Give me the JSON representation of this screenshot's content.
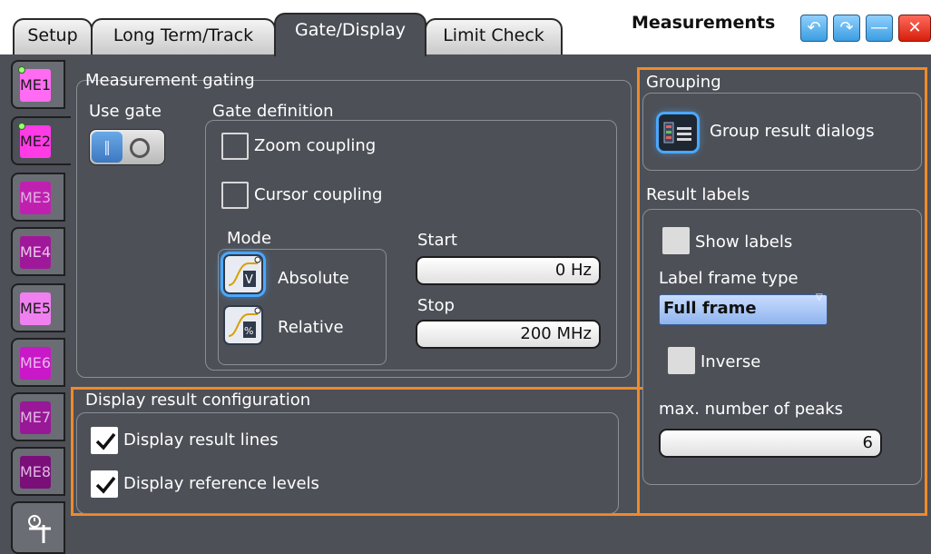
{
  "tabs": [
    "Setup",
    "Long Term/Track",
    "Gate/Display",
    "Limit Check"
  ],
  "window": {
    "title": "Measurements",
    "icons": [
      "undo-icon",
      "redo-icon",
      "minimize-icon",
      "close-icon"
    ]
  },
  "side_tabs": [
    {
      "label": "ME1",
      "color": "#ff6bf2"
    },
    {
      "label": "ME2",
      "color": "#ff3be6"
    },
    {
      "label": "ME3",
      "color": "#c020b0"
    },
    {
      "label": "ME4",
      "color": "#a0189a"
    },
    {
      "label": "ME5",
      "color": "#f080f0"
    },
    {
      "label": "ME6",
      "color": "#c818c8"
    },
    {
      "label": "ME7",
      "color": "#981898"
    },
    {
      "label": "ME8",
      "color": "#7a0f7a"
    }
  ],
  "gating": {
    "title": "Measurement gating",
    "use_gate_label": "Use gate",
    "gate_definition_label": "Gate definition",
    "zoom_coupling": "Zoom coupling",
    "cursor_coupling": "Cursor coupling",
    "mode_label": "Mode",
    "absolute_label": "Absolute",
    "relative_label": "Relative",
    "start_label": "Start",
    "start_value": "0 Hz",
    "stop_label": "Stop",
    "stop_value": "200 MHz"
  },
  "display_config": {
    "title": "Display result configuration",
    "result_lines": "Display result lines",
    "reference_levels": "Display reference levels"
  },
  "grouping": {
    "title": "Grouping",
    "group_dialogs": "Group result dialogs"
  },
  "result_labels": {
    "title": "Result labels",
    "show_labels": "Show labels",
    "frame_type_label": "Label frame type",
    "frame_type_value": "Full frame",
    "inverse": "Inverse",
    "max_peaks_label": "max. number of peaks",
    "max_peaks_value": "6"
  },
  "colors": {
    "panel": "#4d5057",
    "accent_orange": "#ef8a2a",
    "accent_blue": "#4aa8ff"
  }
}
